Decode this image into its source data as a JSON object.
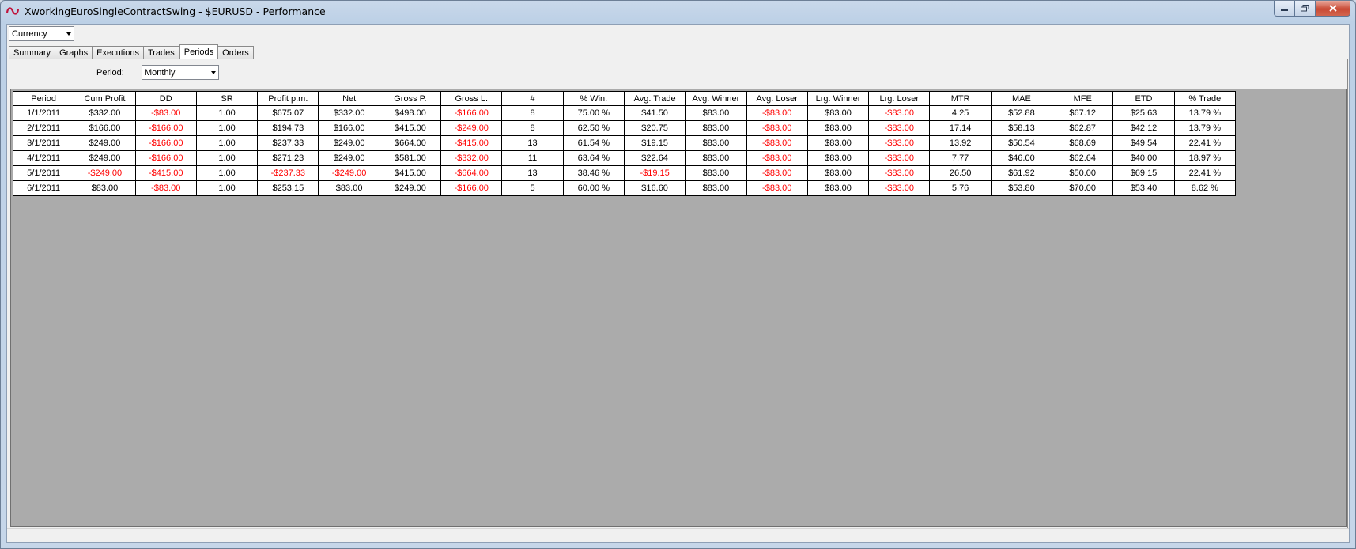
{
  "window": {
    "title": "XworkingEuroSingleContractSwing - $EURUSD - Performance",
    "icon": "ninjatrader-logo-icon"
  },
  "toolbar": {
    "display_unit": {
      "selected": "Currency"
    }
  },
  "tabs": [
    {
      "label": "Summary"
    },
    {
      "label": "Graphs"
    },
    {
      "label": "Executions"
    },
    {
      "label": "Trades"
    },
    {
      "label": "Periods",
      "active": true
    },
    {
      "label": "Orders"
    }
  ],
  "periods_panel": {
    "period_label": "Period:",
    "period_selected": "Monthly"
  },
  "colors": {
    "negative": "#ff0000",
    "grid_background": "#ababab",
    "close_button": "#c94a35"
  },
  "table": {
    "columns": [
      "Period",
      "Cum Profit",
      "DD",
      "SR",
      "Profit p.m.",
      "Net",
      "Gross P.",
      "Gross L.",
      "#",
      "% Win.",
      "Avg. Trade",
      "Avg. Winner",
      "Avg. Loser",
      "Lrg. Winner",
      "Lrg. Loser",
      "MTR",
      "MAE",
      "MFE",
      "ETD",
      "% Trade"
    ],
    "rows": [
      [
        "1/1/2011",
        "$332.00",
        "-$83.00",
        "1.00",
        "$675.07",
        "$332.00",
        "$498.00",
        "-$166.00",
        "8",
        "75.00 %",
        "$41.50",
        "$83.00",
        "-$83.00",
        "$83.00",
        "-$83.00",
        "4.25",
        "$52.88",
        "$67.12",
        "$25.63",
        "13.79 %"
      ],
      [
        "2/1/2011",
        "$166.00",
        "-$166.00",
        "1.00",
        "$194.73",
        "$166.00",
        "$415.00",
        "-$249.00",
        "8",
        "62.50 %",
        "$20.75",
        "$83.00",
        "-$83.00",
        "$83.00",
        "-$83.00",
        "17.14",
        "$58.13",
        "$62.87",
        "$42.12",
        "13.79 %"
      ],
      [
        "3/1/2011",
        "$249.00",
        "-$166.00",
        "1.00",
        "$237.33",
        "$249.00",
        "$664.00",
        "-$415.00",
        "13",
        "61.54 %",
        "$19.15",
        "$83.00",
        "-$83.00",
        "$83.00",
        "-$83.00",
        "13.92",
        "$50.54",
        "$68.69",
        "$49.54",
        "22.41 %"
      ],
      [
        "4/1/2011",
        "$249.00",
        "-$166.00",
        "1.00",
        "$271.23",
        "$249.00",
        "$581.00",
        "-$332.00",
        "11",
        "63.64 %",
        "$22.64",
        "$83.00",
        "-$83.00",
        "$83.00",
        "-$83.00",
        "7.77",
        "$46.00",
        "$62.64",
        "$40.00",
        "18.97 %"
      ],
      [
        "5/1/2011",
        "-$249.00",
        "-$415.00",
        "1.00",
        "-$237.33",
        "-$249.00",
        "$415.00",
        "-$664.00",
        "13",
        "38.46 %",
        "-$19.15",
        "$83.00",
        "-$83.00",
        "$83.00",
        "-$83.00",
        "26.50",
        "$61.92",
        "$50.00",
        "$69.15",
        "22.41 %"
      ],
      [
        "6/1/2011",
        "$83.00",
        "-$83.00",
        "1.00",
        "$253.15",
        "$83.00",
        "$249.00",
        "-$166.00",
        "5",
        "60.00 %",
        "$16.60",
        "$83.00",
        "-$83.00",
        "$83.00",
        "-$83.00",
        "5.76",
        "$53.80",
        "$70.00",
        "$53.40",
        "8.62 %"
      ]
    ]
  }
}
